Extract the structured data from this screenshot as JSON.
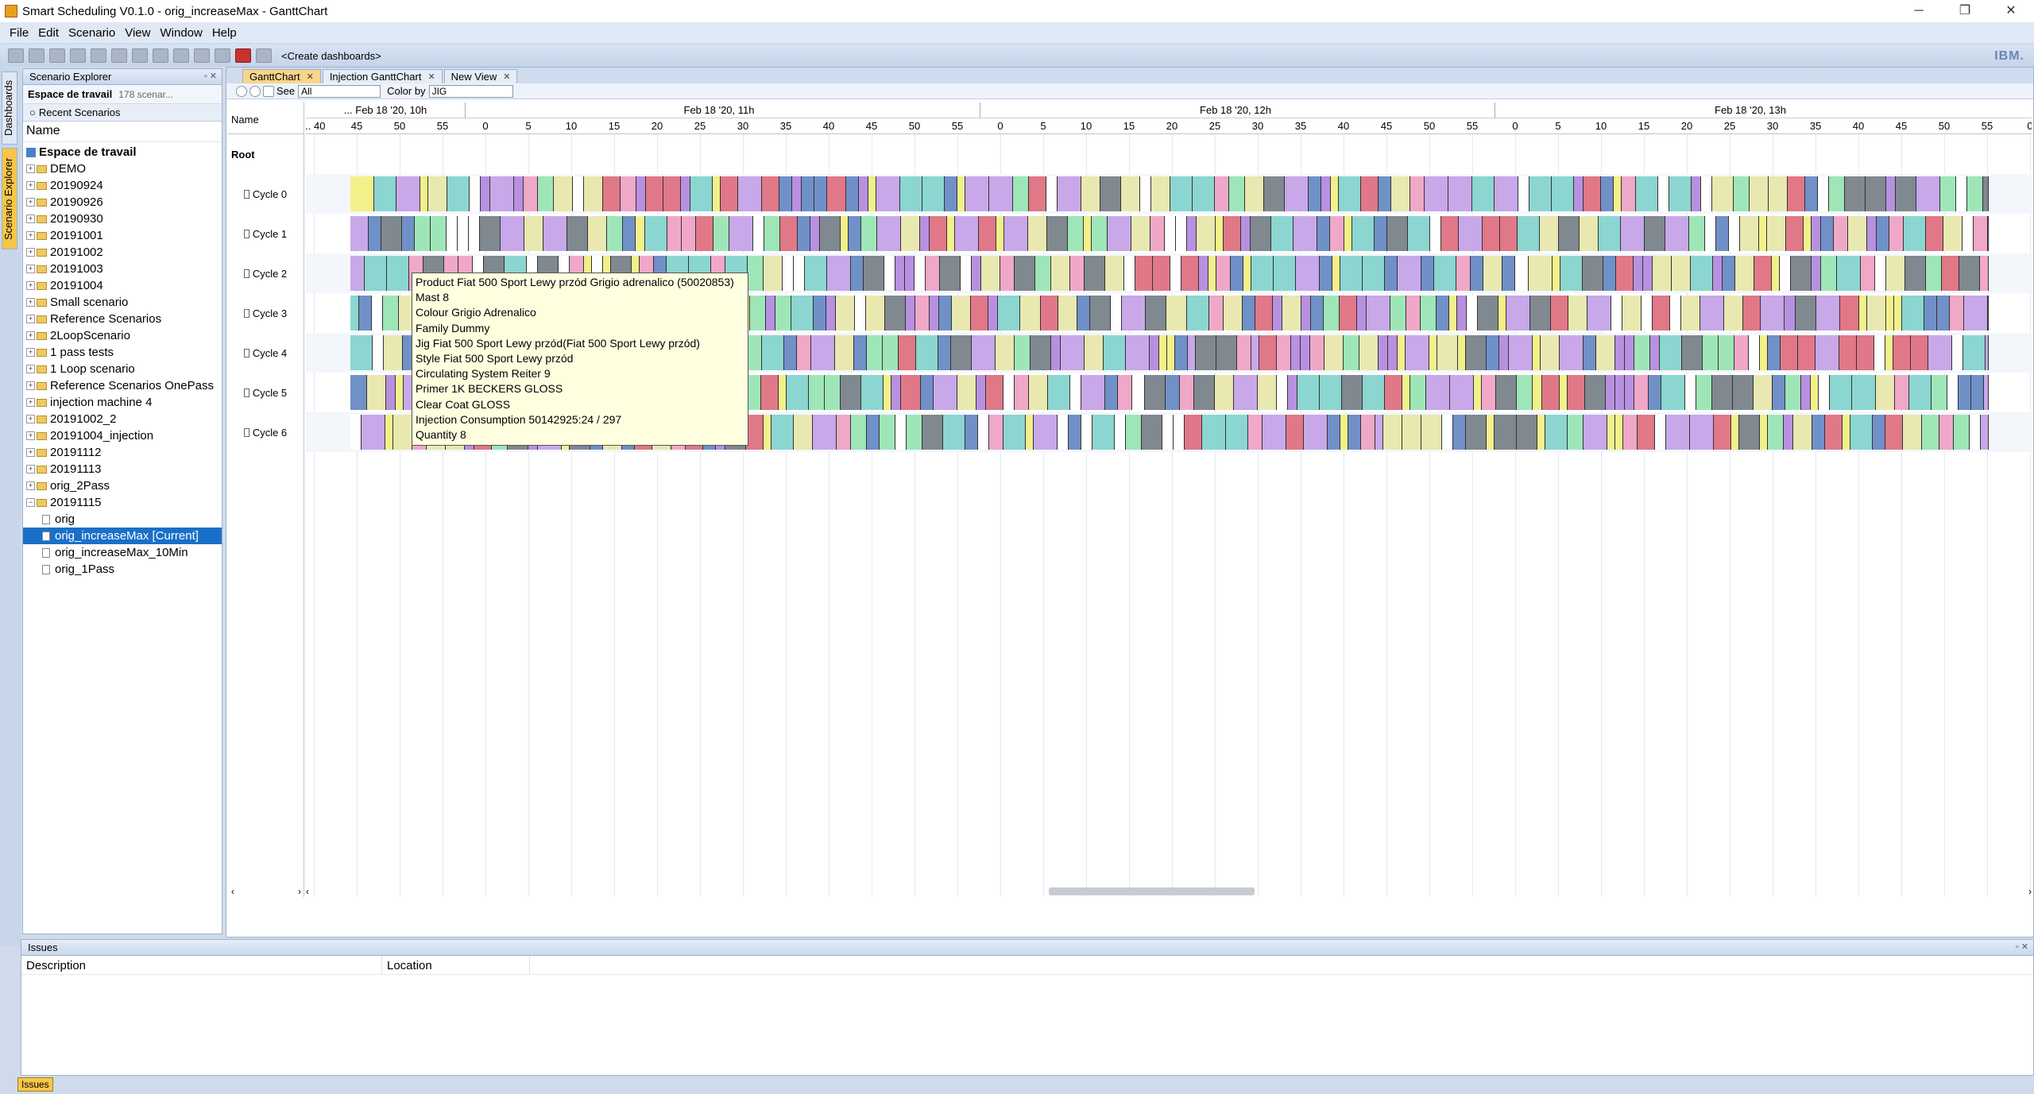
{
  "window": {
    "title": "Smart Scheduling V0.1.0 - orig_increaseMax - GanttChart",
    "controls": [
      "─",
      "❐",
      "✕"
    ]
  },
  "menu": [
    "File",
    "Edit",
    "Scenario",
    "View",
    "Window",
    "Help"
  ],
  "toolbar": {
    "create_dashboards": "<Create dashboards>",
    "brand": "IBM."
  },
  "side_tabs": {
    "dashboards": "Dashboards",
    "scenario_explorer": "Scenario Explorer"
  },
  "explorer": {
    "title": "Scenario Explorer",
    "workspace_label": "Espace de travail",
    "workspace_count": "178 scenar...",
    "recent": "Recent Scenarios",
    "name_header": "Name",
    "items": [
      {
        "label": "Espace de travail",
        "type": "ws",
        "level": 0
      },
      {
        "label": "DEMO",
        "type": "folder",
        "level": 0
      },
      {
        "label": "20190924",
        "type": "folder",
        "level": 0
      },
      {
        "label": "20190926",
        "type": "folder",
        "level": 0
      },
      {
        "label": "20190930",
        "type": "folder",
        "level": 0
      },
      {
        "label": "20191001",
        "type": "folder",
        "level": 0
      },
      {
        "label": "20191002",
        "type": "folder",
        "level": 0
      },
      {
        "label": "20191003",
        "type": "folder",
        "level": 0
      },
      {
        "label": "20191004",
        "type": "folder",
        "level": 0
      },
      {
        "label": "Small scenario",
        "type": "folder",
        "level": 0
      },
      {
        "label": "Reference Scenarios",
        "type": "folder",
        "level": 0
      },
      {
        "label": "2LoopScenario",
        "type": "folder",
        "level": 0
      },
      {
        "label": "1 pass tests",
        "type": "folder",
        "level": 0
      },
      {
        "label": "1 Loop scenario",
        "type": "folder",
        "level": 0
      },
      {
        "label": "Reference Scenarios OnePass",
        "type": "folder",
        "level": 0
      },
      {
        "label": "injection machine 4",
        "type": "folder",
        "level": 0
      },
      {
        "label": "20191002_2",
        "type": "folder",
        "level": 0
      },
      {
        "label": "20191004_injection",
        "type": "folder",
        "level": 0
      },
      {
        "label": "20191112",
        "type": "folder",
        "level": 0
      },
      {
        "label": "20191113",
        "type": "folder",
        "level": 0
      },
      {
        "label": "orig_2Pass",
        "type": "folder",
        "level": 0
      },
      {
        "label": "20191115",
        "type": "folder-open",
        "level": 0
      },
      {
        "label": "orig",
        "type": "doc",
        "level": 1
      },
      {
        "label": "orig_increaseMax [Current]",
        "type": "doc",
        "level": 1,
        "selected": true
      },
      {
        "label": "orig_increaseMax_10Min",
        "type": "doc",
        "level": 1
      },
      {
        "label": "orig_1Pass",
        "type": "doc",
        "level": 1
      }
    ]
  },
  "tabs": [
    {
      "label": "GanttChart",
      "active": true
    },
    {
      "label": "Injection GanttChart",
      "active": false
    },
    {
      "label": "New View",
      "active": false
    }
  ],
  "gantt_tools": {
    "see_label": "See",
    "see_value": "All",
    "color_label": "Color by",
    "color_value": "JIG"
  },
  "gantt": {
    "name_header": "Name",
    "rows": [
      "Root",
      "Cycle 0",
      "Cycle 1",
      "Cycle 2",
      "Cycle 3",
      "Cycle 4",
      "Cycle 5",
      "Cycle 6"
    ],
    "hours": [
      "... Feb 18 '20, 10h",
      "Feb 18 '20, 11h",
      "Feb 18 '20, 12h",
      "Feb 18 '20, 13h"
    ],
    "minute_ticks": [
      "... 40",
      "45",
      "50",
      "55",
      "0",
      "5",
      "10",
      "15",
      "20",
      "25",
      "30",
      "35",
      "40",
      "45",
      "50",
      "55",
      "0",
      "5",
      "10",
      "15",
      "20",
      "25",
      "30",
      "35",
      "40",
      "45",
      "50",
      "55",
      "0",
      "5",
      "10",
      "15",
      "20",
      "25",
      "30",
      "35",
      "40",
      "45",
      "50",
      "55",
      "0"
    ],
    "palette": [
      "#f2f08a",
      "#9ee6b8",
      "#c8a8e8",
      "#f0a8c8",
      "#8bd6d0",
      "#7090c8",
      "#808890",
      "#ffffff",
      "#e8e8b0",
      "#b890e0",
      "#e07888"
    ],
    "scroll_thumb_fraction": 0.3
  },
  "tooltip": [
    "Product Fiat 500 Sport Lewy przód Grigio adrenalico (50020853)",
    "Mast 8",
    "Colour Grigio Adrenalico",
    "Family Dummy",
    "Jig Fiat 500 Sport Lewy przód(Fiat 500 Sport Lewy przód)",
    "Style Fiat 500 Sport Lewy przód",
    "Circulating System Reiter 9",
    "Primer 1K BECKERS GLOSS",
    "Clear Coat GLOSS",
    "Injection Consumption 50142925:24 / 297",
    "Quantity 8"
  ],
  "issues": {
    "title": "Issues",
    "col_description": "Description",
    "col_location": "Location",
    "status_tab": "Issues"
  }
}
